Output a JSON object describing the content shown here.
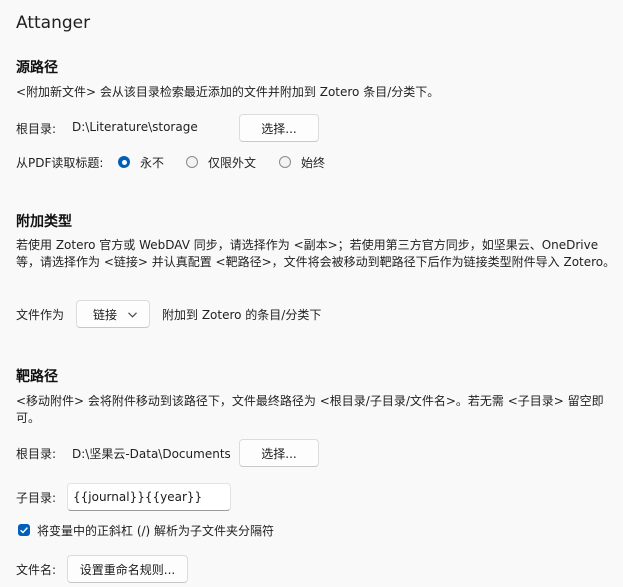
{
  "app_title": "Attanger",
  "source": {
    "heading": "源路径",
    "description": "<附加新文件> 会从该目录检索最近添加的文件并附加到 Zotero 条目/分类下。",
    "root_label": "根目录:",
    "root_value": "D:\\Literature\\storage",
    "choose_button": "选择...",
    "pdf_title_label": "从PDF读取标题:",
    "pdf_title_options": [
      "永不",
      "仅限外文",
      "始终"
    ],
    "pdf_title_selected": "永不"
  },
  "attach_type": {
    "heading": "附加类型",
    "description": "若使用 Zotero 官方或 WebDAV 同步，请选择作为 <副本>；若使用第三方官方同步，如坚果云、OneDrive 等，请选择作为 <链接> 并认真配置 <靶路径>，文件将会被移动到靶路径下后作为链接类型附件导入 Zotero。",
    "file_as_label": "文件作为",
    "file_as_value": "链接",
    "suffix": "附加到 Zotero 的条目/分类下"
  },
  "target": {
    "heading": "靶路径",
    "description": "<移动附件> 会将附件移动到该路径下，文件最终路径为 <根目录/子目录/文件名>。若无需 <子目录> 留空即可。",
    "root_label": "根目录:",
    "root_value": "D:\\坚果云-Data\\Documents\\",
    "choose_button": "选择...",
    "subdir_label": "子目录:",
    "subdir_value": "{{journal}}{{year}}",
    "slash_checkbox_label": "将变量中的正斜杠 (/) 解析为子文件夹分隔符",
    "slash_checkbox_checked": true,
    "filename_label": "文件名:",
    "rename_button": "设置重命名规则..."
  }
}
